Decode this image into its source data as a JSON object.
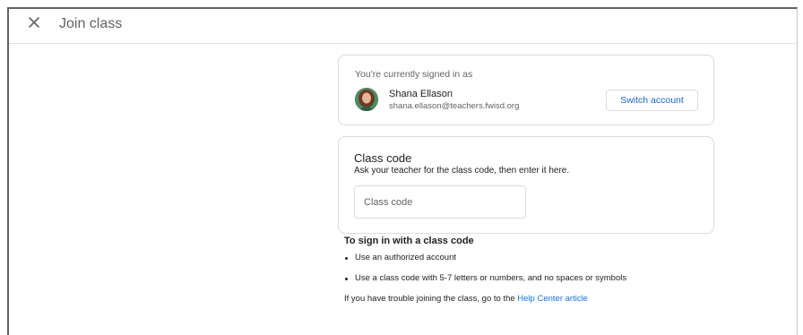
{
  "header": {
    "title": "Join class"
  },
  "account": {
    "label": "You're currently signed in as",
    "name": "Shana Ellason",
    "email": "shana.ellason@teachers.fwisd.org",
    "switch_label": "Switch account"
  },
  "class_code": {
    "title": "Class code",
    "description": "Ask your teacher for the class code, then enter it here.",
    "placeholder": "Class code",
    "value": ""
  },
  "help": {
    "title": "To sign in with a class code",
    "items": [
      "Use an authorized account",
      "Use a class code with 5-7 letters or numbers, and no spaces or symbols"
    ],
    "footer_text": "If you have trouble joining the class, go to the ",
    "link_text": "Help Center article"
  }
}
